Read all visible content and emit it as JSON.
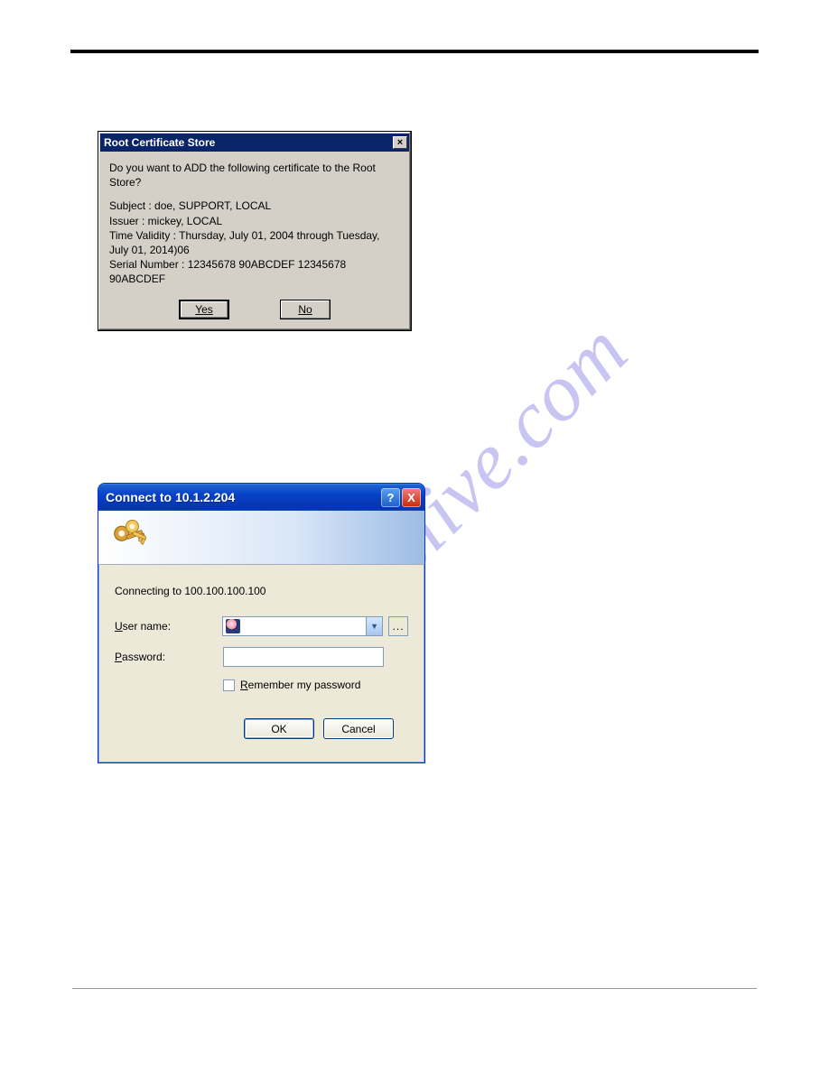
{
  "watermark": "manualslive.com",
  "dialog1": {
    "title": "Root Certificate Store",
    "close_glyph": "×",
    "question": "Do you want to ADD the following certificate to the Root Store?",
    "details": "Subject : doe, SUPPORT, LOCAL\nIssuer : mickey, LOCAL\nTime Validity : Thursday, July 01, 2004 through Tuesday, July 01, 2014)06\nSerial Number : 12345678 90ABCDEF 12345678 90ABCDEF",
    "yes_label": "Yes",
    "no_label": "No"
  },
  "dialog2": {
    "title": "Connect to 10.1.2.204",
    "help_glyph": "?",
    "close_glyph": "X",
    "connecting_text": "Connecting to 100.100.100.100",
    "username_label": "User name:",
    "password_label": "Password:",
    "browse_label": "...",
    "remember_label": "Remember my password",
    "ok_label": "OK",
    "cancel_label": "Cancel"
  }
}
